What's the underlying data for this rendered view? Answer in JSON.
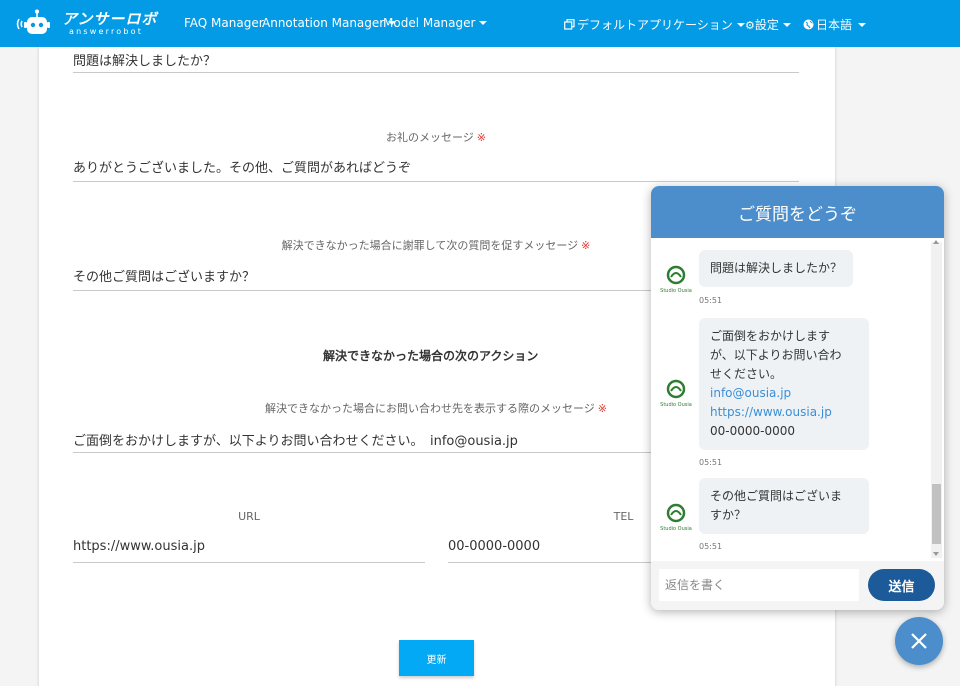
{
  "navbar": {
    "brand_title": "アンサーロボ",
    "brand_sub": "answerrobot",
    "links": {
      "faq": "FAQ Manager",
      "annotation": "Annotation Manager",
      "model": "Model Manager"
    },
    "app_selector": "デフォルトアプリケーション",
    "settings": "設定",
    "language": "日本語",
    "color": "#039be5"
  },
  "form": {
    "resolved_question": {
      "value": "問題は解決しましたか？"
    },
    "thanks_message": {
      "label": "お礼のメッセージ",
      "required_mark": "※",
      "value": "ありがとうございました。その他、ご質問があればどうぞ"
    },
    "apology_message": {
      "label": "解決できなかった場合に謝罪して次の質問を促すメッセージ",
      "required_mark": "※",
      "value": "その他ご質問はございますか？"
    },
    "next_action_title": "解決できなかった場合の次のアクション",
    "contact_message": {
      "label": "解決できなかった場合にお問い合わせ先を表示する際のメッセージ",
      "required_mark": "※",
      "value": "ご面倒をおかけしますが、以下よりお問い合わせください。　info@ousia.jp"
    },
    "url": {
      "label": "URL",
      "value": "https://www.ousia.jp"
    },
    "tel": {
      "label": "TEL",
      "value": "00-0000-0000"
    },
    "update_button": "更新"
  },
  "chat": {
    "header": "ご質問をどうぞ",
    "messages": [
      {
        "text": "問題は解決しましたか？",
        "time": "05:51"
      },
      {
        "lines": [
          "ご面倒をおかけします",
          "が、以下よりお問い合わ",
          "せください。"
        ],
        "email": "info@ousia.jp",
        "url": "https://www.ousia.jp",
        "tel": "00-0000-0000",
        "time": "05:51"
      },
      {
        "lines": [
          "その他ご質問はございま",
          "すか？"
        ],
        "time": "05:51"
      }
    ],
    "avatar_label": "Studio Ousia",
    "reply_placeholder": "返信を書く",
    "send_label": "送信",
    "header_color": "#4b8ecb",
    "send_color": "#1d5a9a"
  }
}
